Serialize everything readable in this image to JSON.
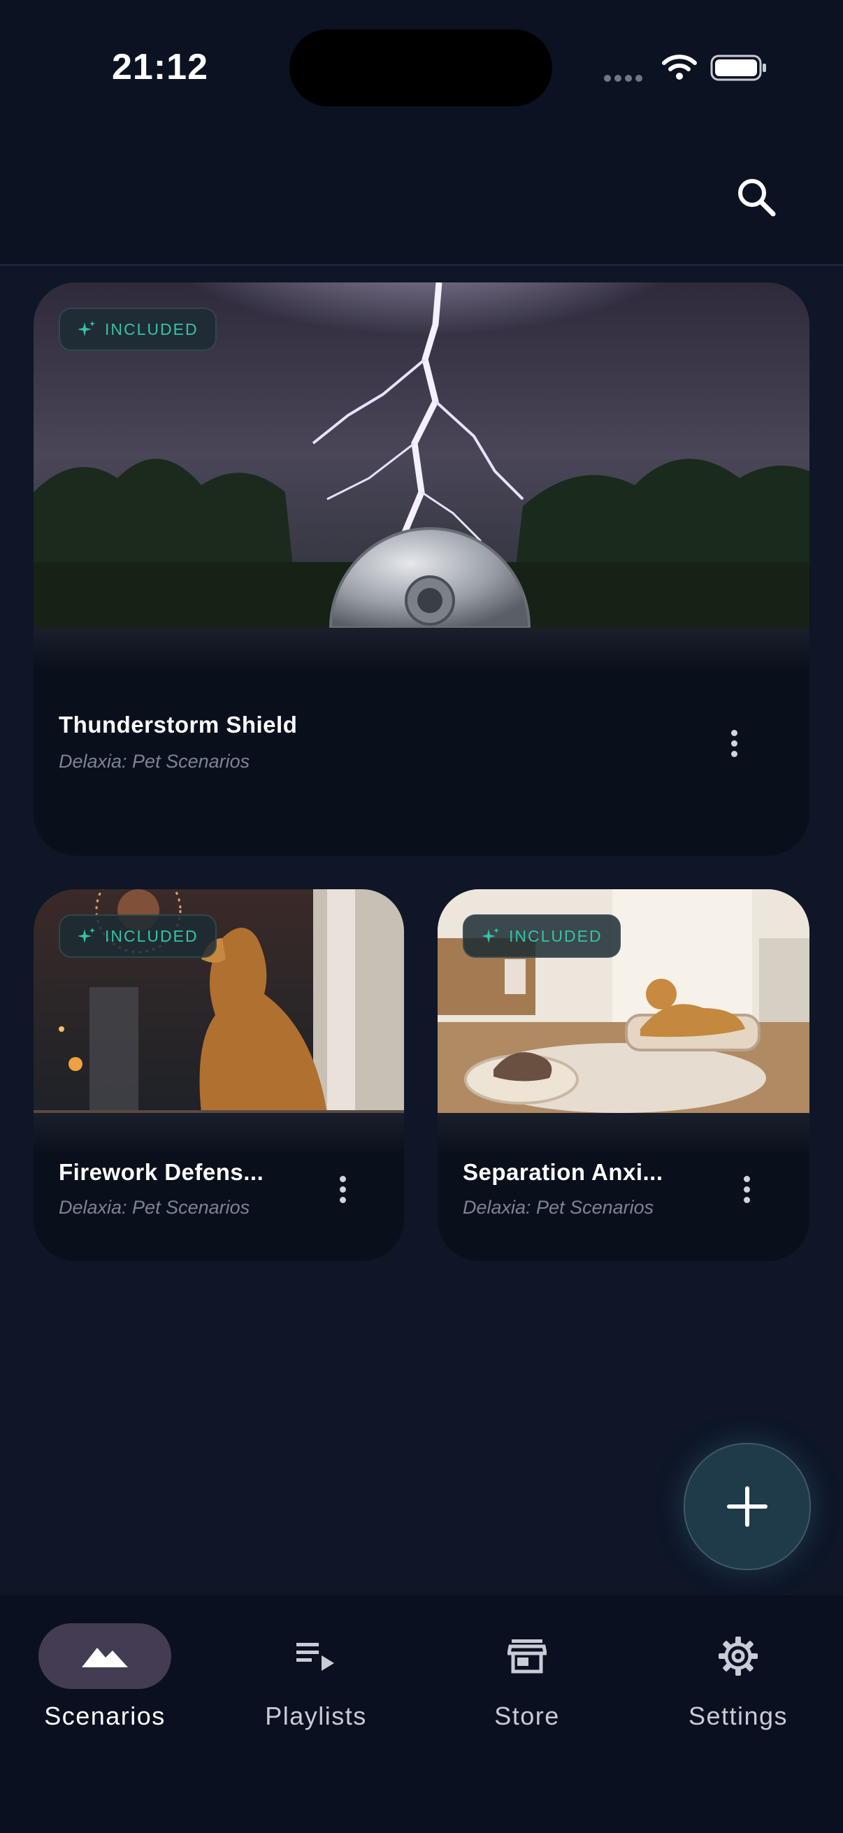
{
  "status_bar": {
    "time": "21:12",
    "icons": [
      "signal-dots-icon",
      "wifi-icon",
      "battery-icon"
    ]
  },
  "header": {
    "search_icon": "search-icon"
  },
  "cards": [
    {
      "badge": "INCLUDED",
      "title": "Thunderstorm Shield",
      "subtitle": "Delaxia: Pet Scenarios",
      "image": "lightning-storm-shield-image"
    },
    {
      "badge": "INCLUDED",
      "title": "Firework Defens...",
      "subtitle": "Delaxia: Pet Scenarios",
      "image": "dog-fireworks-window-image"
    },
    {
      "badge": "INCLUDED",
      "title": "Separation Anxi...",
      "subtitle": "Delaxia: Pet Scenarios",
      "image": "dog-cat-living-room-image"
    }
  ],
  "fab": {
    "icon": "plus-icon"
  },
  "bottom_nav": [
    {
      "label": "Scenarios",
      "icon": "mountains-icon",
      "active": true
    },
    {
      "label": "Playlists",
      "icon": "playlist-icon",
      "active": false
    },
    {
      "label": "Store",
      "icon": "store-icon",
      "active": false
    },
    {
      "label": "Settings",
      "icon": "gear-icon",
      "active": false
    }
  ],
  "colors": {
    "background": "#0e1628",
    "card": "#0a0f1c",
    "badge_text": "#34c4a6",
    "nav_active_pill": "#433c52",
    "fab": "#1f3a48"
  }
}
